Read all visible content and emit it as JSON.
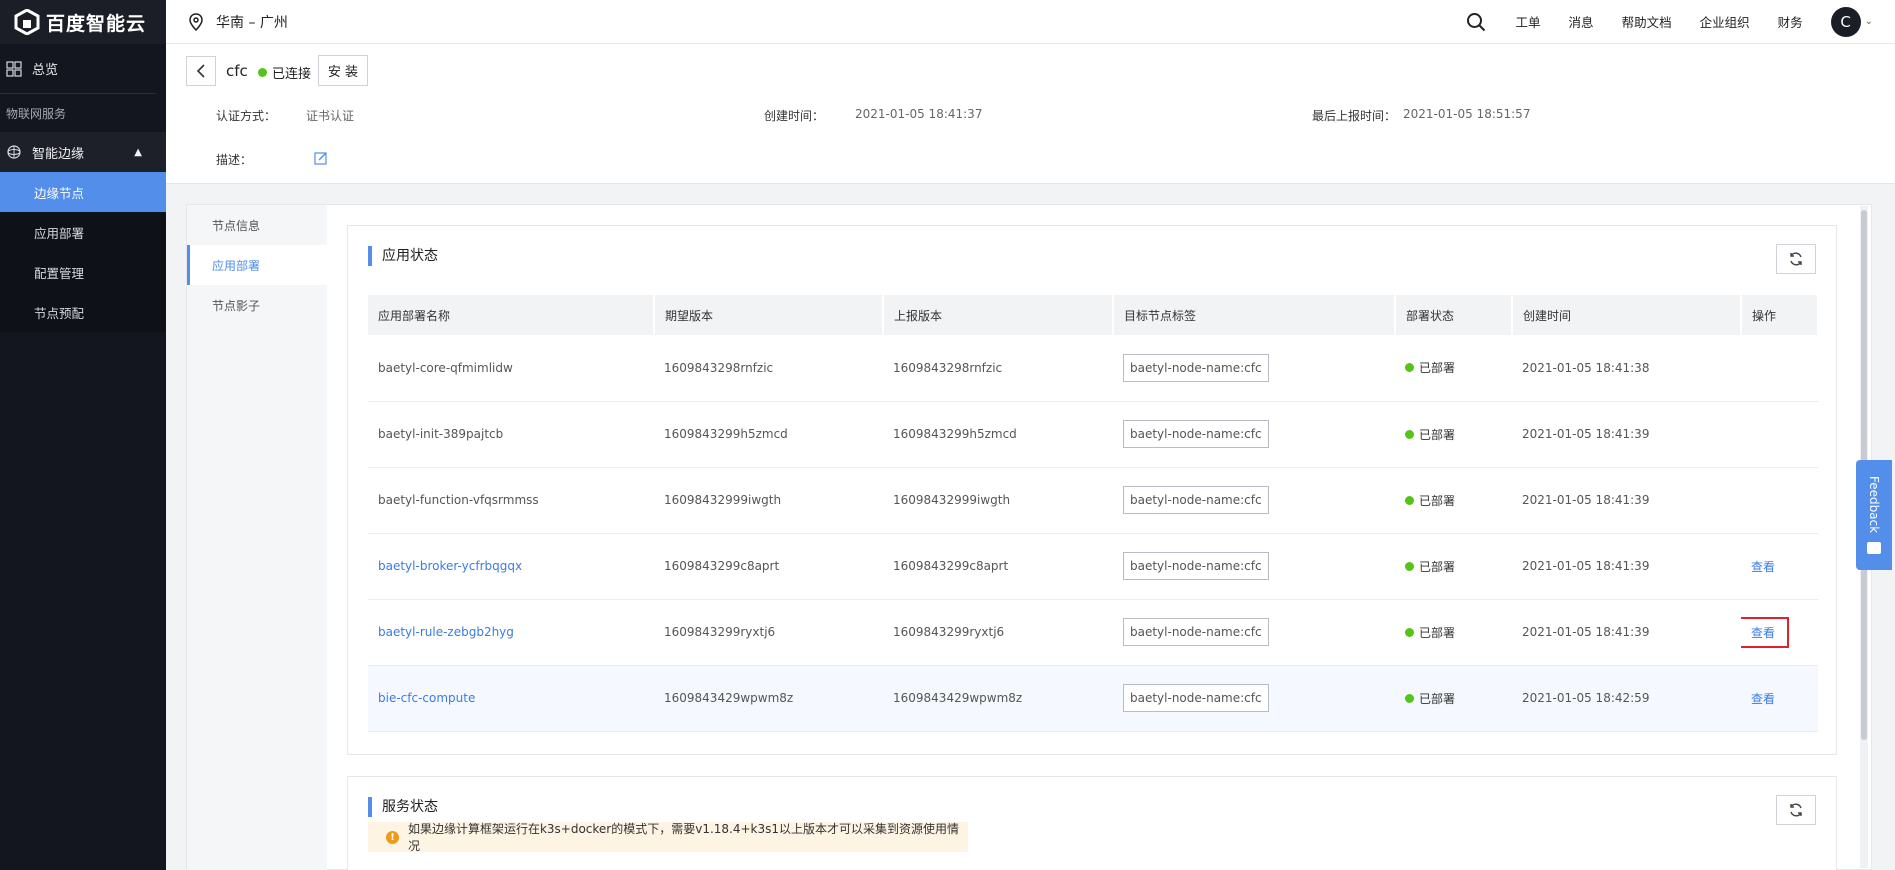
{
  "brand": {
    "name": "百度智能云"
  },
  "sidebar": {
    "overview": "总览",
    "section": "物联网服务",
    "group": "智能边缘",
    "items": [
      {
        "label": "边缘节点",
        "active": true
      },
      {
        "label": "应用部署",
        "active": false
      },
      {
        "label": "配置管理",
        "active": false
      },
      {
        "label": "节点预配",
        "active": false
      }
    ]
  },
  "topbar": {
    "region": "华南 – 广州",
    "nav": [
      "工单",
      "消息",
      "帮助文档",
      "企业组织",
      "财务"
    ],
    "avatar": "C"
  },
  "node": {
    "name": "cfc",
    "connection": "已连接",
    "install": "安 装",
    "auth_label": "认证方式：",
    "auth_value": "证书认证",
    "created_label": "创建时间：",
    "created_value": "2021-01-05 18:41:37",
    "reported_label": "最后上报时间：",
    "reported_value": "2021-01-05 18:51:57",
    "desc_label": "描述："
  },
  "tabs": [
    {
      "label": "节点信息",
      "active": false
    },
    {
      "label": "应用部署",
      "active": true
    },
    {
      "label": "节点影子",
      "active": false
    }
  ],
  "app_status": {
    "title": "应用状态",
    "columns": [
      "应用部署名称",
      "期望版本",
      "上报版本",
      "目标节点标签",
      "部署状态",
      "创建时间",
      "操作"
    ],
    "rows": [
      {
        "name": "baetyl-core-qfmimlidw",
        "link": false,
        "expected": "1609843298rnfzic",
        "reported": "1609843298rnfzic",
        "tag": "baetyl-node-name:cfc",
        "status": "已部署",
        "created": "2021-01-05 18:41:38",
        "op": ""
      },
      {
        "name": "baetyl-init-389pajtcb",
        "link": false,
        "expected": "1609843299h5zmcd",
        "reported": "1609843299h5zmcd",
        "tag": "baetyl-node-name:cfc",
        "status": "已部署",
        "created": "2021-01-05 18:41:39",
        "op": ""
      },
      {
        "name": "baetyl-function-vfqsrmmss",
        "link": false,
        "expected": "16098432999iwgth",
        "reported": "16098432999iwgth",
        "tag": "baetyl-node-name:cfc",
        "status": "已部署",
        "created": "2021-01-05 18:41:39",
        "op": ""
      },
      {
        "name": "baetyl-broker-ycfrbqgqx",
        "link": true,
        "expected": "1609843299c8aprt",
        "reported": "1609843299c8aprt",
        "tag": "baetyl-node-name:cfc",
        "status": "已部署",
        "created": "2021-01-05 18:41:39",
        "op": "查看"
      },
      {
        "name": "baetyl-rule-zebgb2hyg",
        "link": true,
        "expected": "1609843299ryxtj6",
        "reported": "1609843299ryxtj6",
        "tag": "baetyl-node-name:cfc",
        "status": "已部署",
        "created": "2021-01-05 18:41:39",
        "op": "查看"
      },
      {
        "name": "bie-cfc-compute",
        "link": true,
        "expected": "1609843429wpwm8z",
        "reported": "1609843429wpwm8z",
        "tag": "baetyl-node-name:cfc",
        "status": "已部署",
        "created": "2021-01-05 18:42:59",
        "op": "查看"
      }
    ]
  },
  "service_status": {
    "title": "服务状态",
    "notice": "如果边缘计算框架运行在k3s+docker的模式下，需要v1.18.4+k3s1以上版本才可以采集到资源使用情况"
  },
  "feedback": "Feedback",
  "colors": {
    "accent": "#528eea",
    "link": "#3a7be6",
    "success": "#52c41a",
    "highlight": "#e0202a",
    "sidebar_bg": "#13161f"
  }
}
